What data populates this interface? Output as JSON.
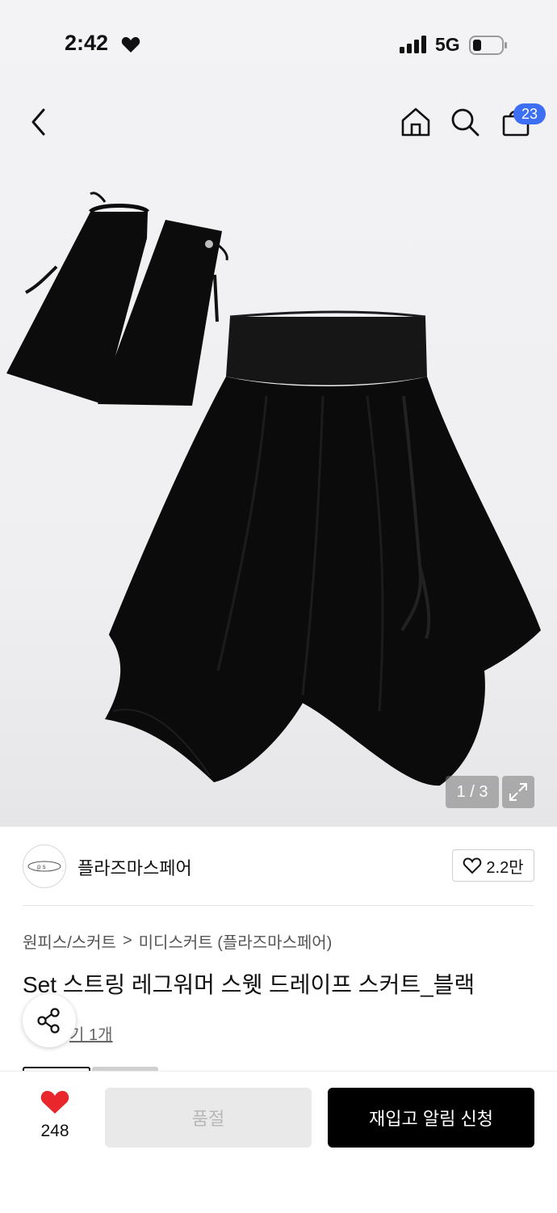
{
  "status_bar": {
    "time": "2:42",
    "network": "5G",
    "notification_icon": "heart-icon"
  },
  "nav": {
    "back_icon": "chevron-left-icon",
    "home_icon": "home-icon",
    "search_icon": "search-icon",
    "cart_icon": "shopping-bag-icon",
    "cart_count": "23"
  },
  "gallery": {
    "counter": "1 / 3",
    "expand_icon": "expand-icon"
  },
  "shop": {
    "logo_text": "p s",
    "name": "플라즈마스페어",
    "like_count": "2.2만"
  },
  "breadcrumb": {
    "level1": "원피스/스커트",
    "separator": ">",
    "level2": "미디스커트 (플라즈마스페어)"
  },
  "product": {
    "title": "Set 스트링 레그워머 스웻 드레이프 스커트_블랙",
    "review_link": "기 1개"
  },
  "bottom_bar": {
    "wish_count": "248",
    "soldout_label": "품절",
    "restock_label": "재입고 알림 신청"
  },
  "colors": {
    "badge": "#3d6ff5",
    "heart": "#e8262b",
    "cta": "#000000",
    "disabled": "#e9e9e9"
  }
}
